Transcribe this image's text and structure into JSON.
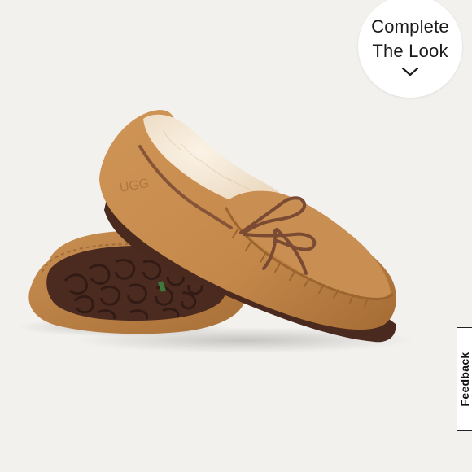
{
  "product": {
    "image_alt": "moccasin slipper pair"
  },
  "complete_look": {
    "line1": "Complete",
    "line2": "The Look",
    "icon": "chevron-down-icon"
  },
  "feedback": {
    "label": "Feedback"
  },
  "colors": {
    "background": "#f2f1ee",
    "suede": "#c58a4c",
    "suede_dark": "#9a6431",
    "shearling": "#f4e7d4",
    "sole": "#4a2a1f",
    "lace": "#7a4a32"
  }
}
